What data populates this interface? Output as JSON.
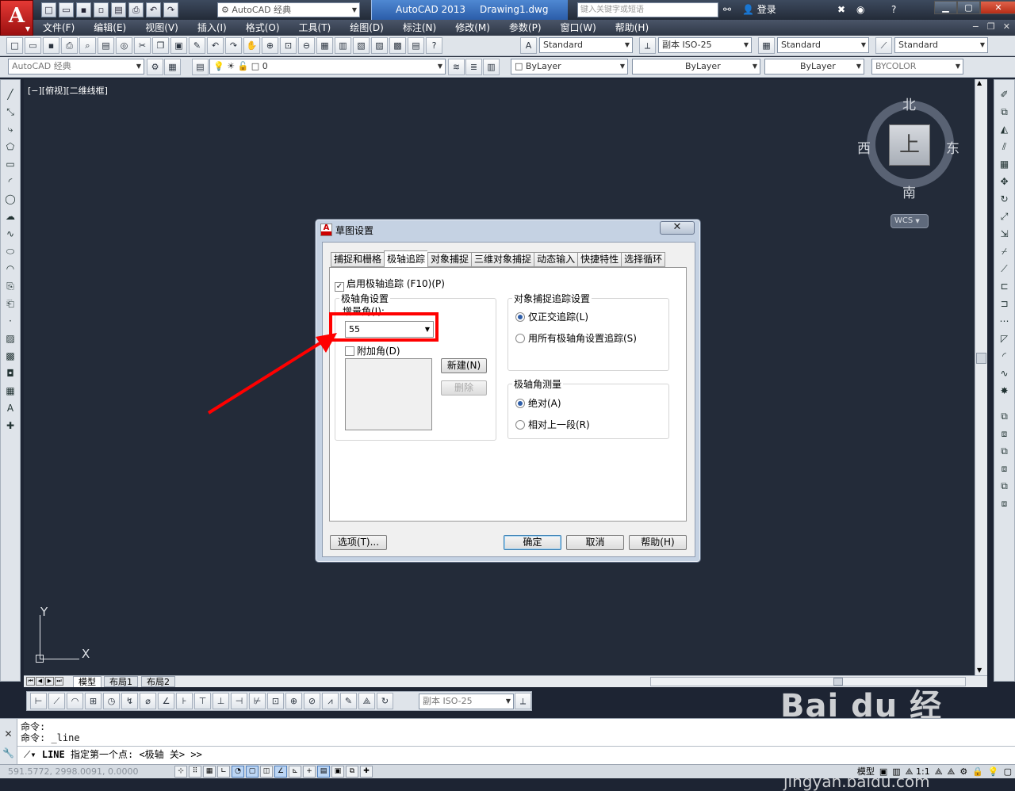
{
  "titlebar": {
    "app_logo": "A",
    "workspace": "AutoCAD 经典",
    "product": "AutoCAD 2013",
    "document": "Drawing1.dwg",
    "search_placeholder": "键入关键字或短语",
    "login": "登录"
  },
  "menu": [
    "文件(F)",
    "编辑(E)",
    "视图(V)",
    "插入(I)",
    "格式(O)",
    "工具(T)",
    "绘图(D)",
    "标注(N)",
    "修改(M)",
    "参数(P)",
    "窗口(W)",
    "帮助(H)"
  ],
  "styles_toolbar": {
    "text_style": "Standard",
    "dim_style": "副本 ISO-25",
    "table_style": "Standard",
    "mleader_style": "Standard"
  },
  "layers_toolbar": {
    "workspace": "AutoCAD 经典",
    "layer": "0",
    "color": "ByLayer",
    "linetype": "ByLayer",
    "lineweight": "ByLayer",
    "plotstyle": "BYCOLOR"
  },
  "viewport": {
    "label": "[−][俯视][二维线框]",
    "compass": {
      "north": "北",
      "south": "南",
      "east": "东",
      "west": "西",
      "face": "上"
    },
    "wcs": "WCS",
    "ucs": {
      "y": "Y",
      "x": "X"
    }
  },
  "layout_tabs": [
    "模型",
    "布局1",
    "布局2"
  ],
  "dim_toolbar": {
    "dim_style": "副本 ISO-25"
  },
  "command": {
    "history": [
      "命令:",
      "命令: _line"
    ],
    "prompt_cmd": "LINE",
    "prompt_text": "指定第一个点: <极轴 关> >>"
  },
  "statusbar": {
    "coords": "591.5772, 2998.0091, 0.0000",
    "model": "模型",
    "scale": "1:1"
  },
  "dialog": {
    "title": "草图设置",
    "close": "✕",
    "tabs": [
      "捕捉和栅格",
      "极轴追踪",
      "对象捕捉",
      "三维对象捕捉",
      "动态输入",
      "快捷特性",
      "选择循环"
    ],
    "active_tab": "极轴追踪",
    "enable_polar": "启用极轴追踪 (F10)(P)",
    "polar_group": "极轴角设置",
    "increment_label": "增量角(I):",
    "increment_value": "55",
    "additional_label": "附加角(D)",
    "new_button": "新建(N)",
    "delete_button": "删除",
    "snap_group": "对象捕捉追踪设置",
    "ortho_only": "仅正交追踪(L)",
    "all_polar": "用所有极轴角设置追踪(S)",
    "measure_group": "极轴角测量",
    "absolute": "绝对(A)",
    "relative": "相对上一段(R)",
    "options_button": "选项(T)...",
    "ok_button": "确定",
    "cancel_button": "取消",
    "help_button": "帮助(H)"
  },
  "annotation": {
    "highlight_color": "#ff0000"
  },
  "watermark": {
    "logo": "Bai du 经验",
    "url": "jingyan.baidu.com"
  }
}
